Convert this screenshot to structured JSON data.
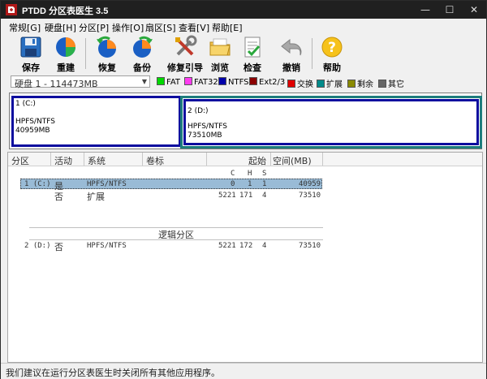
{
  "app": {
    "title": "PTDD 分区表医生 3.5"
  },
  "window_controls": {
    "minimize": "—",
    "maximize": "☐",
    "close": "✕"
  },
  "menu": [
    "常规[G]",
    "硬盘[H]",
    "分区[P]",
    "操作[O]",
    "扇区[S]",
    "查看[V]",
    "帮助[E]"
  ],
  "toolbar": {
    "save": "保存",
    "rebuild": "重建",
    "restore": "恢复",
    "backup": "备份",
    "repair_boot": "修复引导",
    "browse": "浏览",
    "check": "检查",
    "undo": "撤销",
    "help": "帮助"
  },
  "disk_select": {
    "value": "硬盘 1 - 114473MB"
  },
  "legend": [
    {
      "label": "FAT",
      "color": "#00d800"
    },
    {
      "label": "FAT32",
      "color": "#ff3cf0"
    },
    {
      "label": "NTFS",
      "color": "#0000aa"
    },
    {
      "label": "Ext2/3",
      "color": "#8b0000"
    },
    {
      "label": "交换",
      "color": "#e00000"
    },
    {
      "label": "扩展",
      "color": "#008a8a"
    },
    {
      "label": "剩余",
      "color": "#8a8a00"
    },
    {
      "label": "其它",
      "color": "#666666"
    }
  ],
  "diskmap": {
    "p1": {
      "title": "1 (C:)",
      "fs": "HPFS/NTFS",
      "size": "40959MB"
    },
    "p2": {
      "title": "2 (D:)",
      "fs": "HPFS/NTFS",
      "size": "73510MB"
    }
  },
  "table": {
    "headers": {
      "part": "分区",
      "active": "活动",
      "system": "系统",
      "label": "卷标",
      "start": "起始",
      "space": "空间(MB)"
    },
    "subheaders": {
      "c": "C",
      "h": "H",
      "s": "S"
    },
    "rows": [
      {
        "part": "1 (C:)",
        "active": "是",
        "system": "HPFS/NTFS",
        "c": "0",
        "h": "1",
        "s": "1",
        "space": "40959"
      },
      {
        "part": "",
        "active": "否",
        "system": "扩展",
        "c": "5221",
        "h": "171",
        "s": "4",
        "space": "73510"
      }
    ],
    "logical_header": "逻辑分区",
    "logical_rows": [
      {
        "part": "2 (D:)",
        "active": "否",
        "system": "HPFS/NTFS",
        "c": "5221",
        "h": "172",
        "s": "4",
        "space": "73510"
      }
    ]
  },
  "status": "我们建议在运行分区表医生时关闭所有其他应用程序。"
}
